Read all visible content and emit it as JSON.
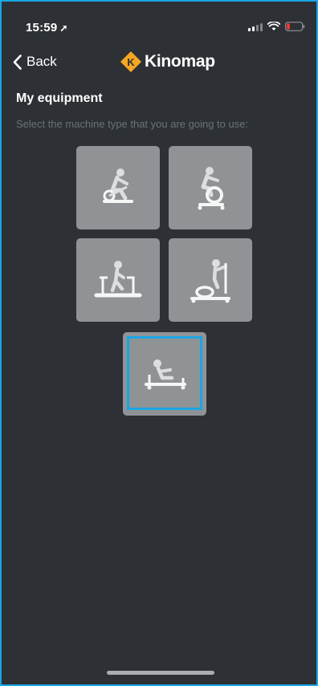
{
  "status_bar": {
    "time": "15:59",
    "location_glyph": "➚"
  },
  "nav": {
    "back_label": "Back",
    "brand_name": "Kinomap",
    "brand_badge_letter": "K"
  },
  "page": {
    "title": "My equipment",
    "subtitle": "Select the machine type that you are going to use:"
  },
  "machines": [
    {
      "id": "bike",
      "icon": "bike-icon",
      "selected": false
    },
    {
      "id": "home-trainer",
      "icon": "home-trainer-icon",
      "selected": false
    },
    {
      "id": "treadmill",
      "icon": "treadmill-icon",
      "selected": false
    },
    {
      "id": "elliptical",
      "icon": "elliptical-icon",
      "selected": false
    },
    {
      "id": "rower",
      "icon": "rower-icon",
      "selected": true
    }
  ],
  "colors": {
    "background": "#2d3135",
    "tile": "#8f9396",
    "accent": "#1aa6e4",
    "brand": "#f5a623"
  }
}
